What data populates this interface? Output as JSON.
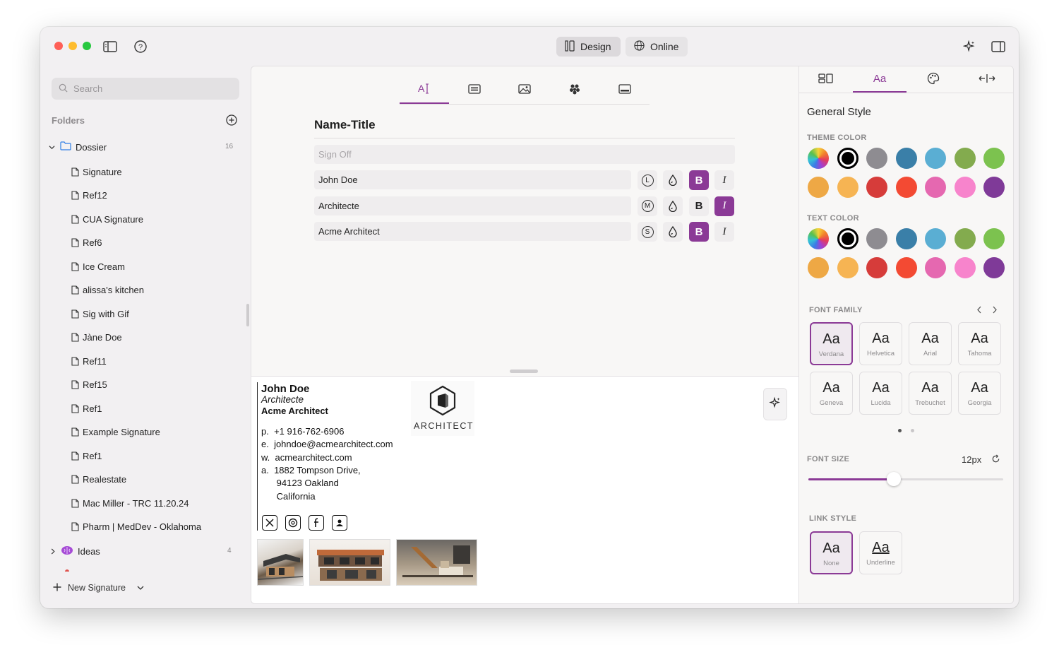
{
  "titlebar": {
    "design_label": "Design",
    "online_label": "Online"
  },
  "sidebar": {
    "search_placeholder": "Search",
    "folders_label": "Folders",
    "dossier": {
      "label": "Dossier",
      "count": "16"
    },
    "items": [
      "Signature",
      "Ref12",
      "CUA Signature",
      "Ref6",
      "Ice Cream",
      "alissa's kitchen",
      "Sig with Gif",
      "Jàne Doe",
      "Ref11",
      "Ref15",
      "Ref1",
      "Example Signature",
      "Ref1",
      "Realestate",
      "Mac Miller - TRC 11.20.24",
      "Pharm | MedDev - Oklahoma"
    ],
    "ideas": {
      "label": "Ideas",
      "count": "4"
    },
    "new_signature_label": "New Signature"
  },
  "editor": {
    "section_title": "Name-Title",
    "signoff_placeholder": "Sign Off",
    "fields": [
      {
        "value": "John Doe",
        "size_letter": "L",
        "bold": true,
        "italic": false
      },
      {
        "value": "Architecte",
        "size_letter": "M",
        "bold": false,
        "italic": true
      },
      {
        "value": "Acme Architect",
        "size_letter": "S",
        "bold": true,
        "italic": false
      }
    ],
    "bold_glyph": "B",
    "italic_glyph": "I"
  },
  "preview": {
    "name": "John Doe",
    "title": "Architecte",
    "company": "Acme Architect",
    "logo_text": "ARCHITECT",
    "contacts": [
      "p.  +1 916-762-6906",
      "e.  johndoe@acmearchitect.com",
      "w.  acmearchitect.com",
      "a.  1882 Tompson Drive,",
      "      94123 Oakland",
      "      California"
    ],
    "social_icons": [
      "x-icon",
      "threads-icon",
      "facebook-icon",
      "contact-icon"
    ]
  },
  "style_panel": {
    "general_style": "General Style",
    "theme_color_label": "THEME COLOR",
    "text_color_label": "TEXT COLOR",
    "colors_row1": [
      "rainbow",
      "#000000",
      "#8e8c91",
      "#3a7fa8",
      "#5aaed3",
      "#83ab4e",
      "#7cc24f"
    ],
    "colors_row2": [
      "#eea845",
      "#f6b453",
      "#d63c3a",
      "#f34a33",
      "#e568b0",
      "#f784cc",
      "#7f3a98"
    ],
    "font_family_label": "FONT FAMILY",
    "fonts": [
      {
        "name": "Verdana",
        "selected": true
      },
      {
        "name": "Helvetica",
        "selected": false
      },
      {
        "name": "Arial",
        "selected": false
      },
      {
        "name": "Tahoma",
        "selected": false
      },
      {
        "name": "Geneva",
        "selected": false
      },
      {
        "name": "Lucida",
        "selected": false
      },
      {
        "name": "Trebuchet",
        "selected": false
      },
      {
        "name": "Georgia",
        "selected": false
      }
    ],
    "font_sample": "Aa",
    "font_size_label": "FONT SIZE",
    "font_size_value": "12px",
    "font_size_fraction": 0.44,
    "link_style_label": "LINK STYLE",
    "link_styles": [
      {
        "name": "None",
        "selected": true
      },
      {
        "name": "Underline",
        "selected": false
      }
    ]
  }
}
